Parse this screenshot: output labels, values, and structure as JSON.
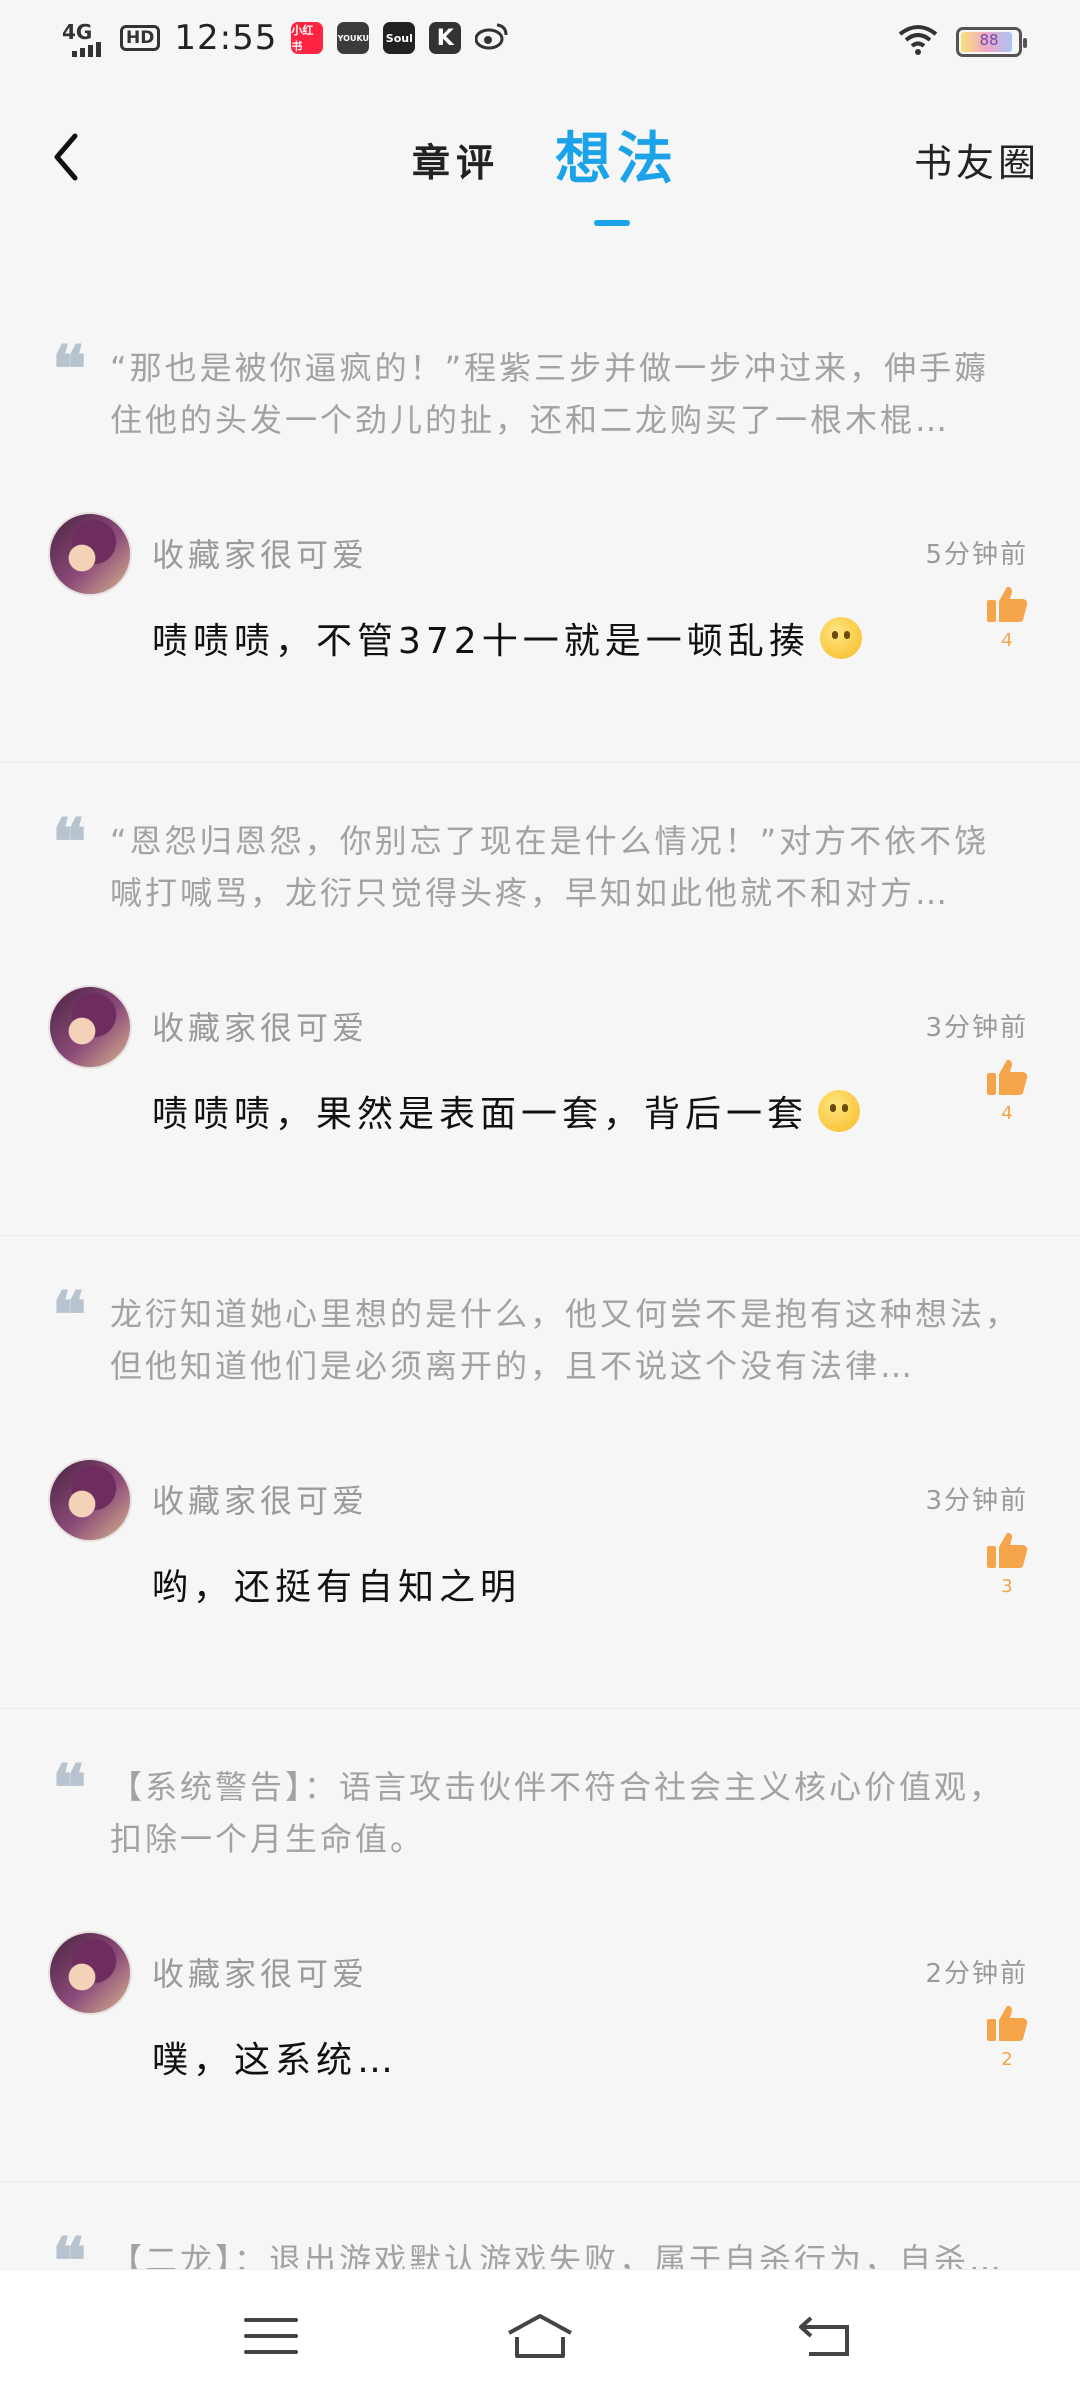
{
  "status_bar": {
    "network": "4G",
    "hd": "HD",
    "time": "12:55",
    "apps": [
      {
        "name": "小红书",
        "color": "#ff2442",
        "label": "小红书"
      },
      {
        "name": "youku",
        "color": "#3b3b3b",
        "label": "YOUKU"
      },
      {
        "name": "soul",
        "color": "#222222",
        "label": "Soul"
      },
      {
        "name": "k",
        "color": "#333333",
        "label": "K"
      }
    ],
    "battery": "88",
    "battery_level": 0.88
  },
  "header": {
    "tab_review": "章评",
    "tab_thought": "想法",
    "friends": "书友圈",
    "accent": "#1aa3e8"
  },
  "cards": [
    {
      "quote": "“那也是被你逼疯的！”程紫三步并做一步冲过来，伸手薅住他的头发一个劲儿的扯，还和二龙购买了一根木棍…",
      "user": "收藏家很可爱",
      "time": "5分钟前",
      "text": "啧啧啧，不管372十一就是一顿乱揍",
      "likes": "4"
    },
    {
      "quote": "“恩怨归恩怨，你别忘了现在是什么情况！”对方不依不饶喊打喊骂，龙衍只觉得头疼，早知如此他就不和对方…",
      "user": "收藏家很可爱",
      "time": "3分钟前",
      "text": "啧啧啧，果然是表面一套，背后一套",
      "likes": "4"
    },
    {
      "quote": "龙衍知道她心里想的是什么，他又何尝不是抱有这种想法，但他知道他们是必须离开的，且不说这个没有法律…",
      "user": "收藏家很可爱",
      "time": "3分钟前",
      "text": "哟，还挺有自知之明",
      "likes": "3"
    },
    {
      "quote": "【系统警告】：语言攻击伙伴不符合社会主义核心价值观，扣除一个月生命值。",
      "user": "收藏家很可爱",
      "time": "2分钟前",
      "text": "噗，这系统…",
      "likes": "2"
    }
  ],
  "last_quote": "【二龙】：退出游戏默认游戏失败，属于自杀行为，自杀…",
  "like_color": "#f5a44a"
}
